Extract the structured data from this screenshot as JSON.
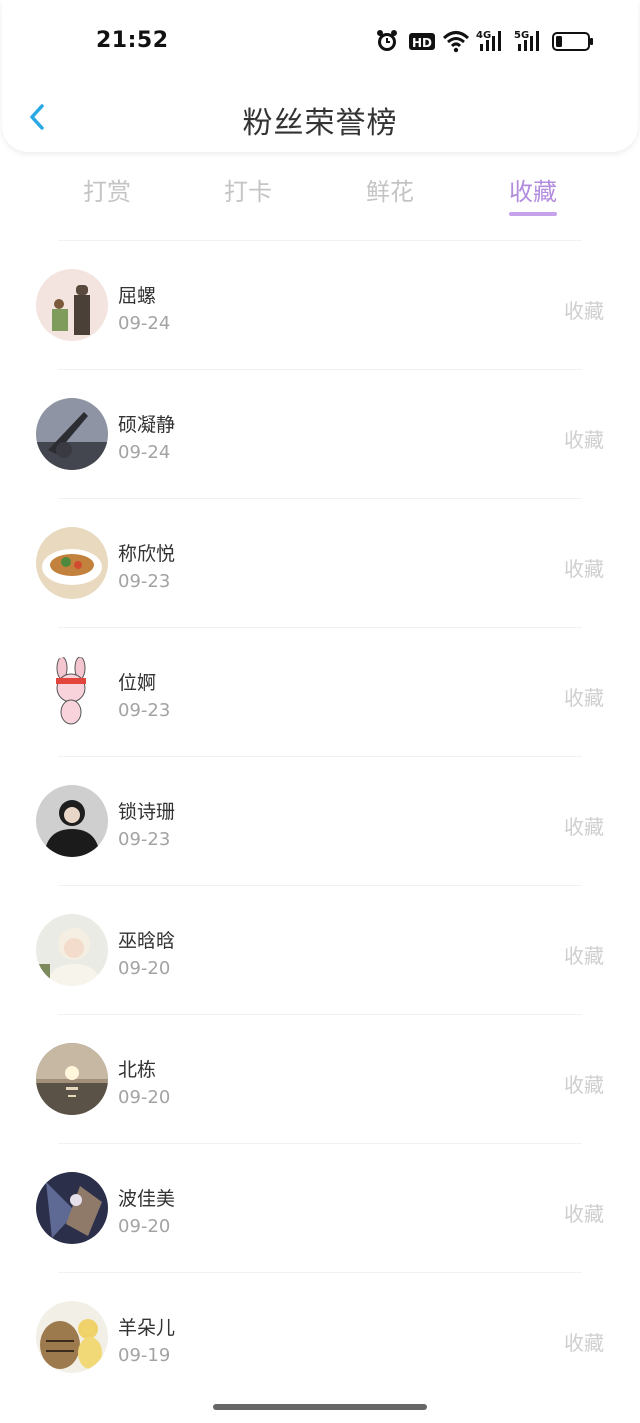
{
  "status_bar": {
    "time": "21:52",
    "icons": [
      "alarm-icon",
      "hd-icon",
      "wifi-icon",
      "signal-4g-icon",
      "signal-5g-icon",
      "battery-icon"
    ],
    "hd_label": "HD",
    "net1_label": "4G",
    "net2_label": "5G"
  },
  "nav": {
    "title": "粉丝荣誉榜",
    "back_icon": "chevron-left-icon"
  },
  "tabs": [
    {
      "label": "打赏",
      "active": false
    },
    {
      "label": "打卡",
      "active": false
    },
    {
      "label": "鲜花",
      "active": false
    },
    {
      "label": "收藏",
      "active": true
    }
  ],
  "colors": {
    "accent": "#b38cde",
    "back_icon": "#29a8e6",
    "inactive_tab": "#c4c4c4",
    "action_text": "#cfcfcf"
  },
  "fans": [
    {
      "name": "屈螺",
      "date": "09-24",
      "action": "收藏",
      "avatar": "couple-illustration-avatar"
    },
    {
      "name": "硕凝静",
      "date": "09-24",
      "action": "收藏",
      "avatar": "dark-landscape-avatar"
    },
    {
      "name": "称欣悦",
      "date": "09-23",
      "action": "收藏",
      "avatar": "food-bowl-avatar"
    },
    {
      "name": "位婀",
      "date": "09-23",
      "action": "收藏",
      "avatar": "cartoon-bunny-avatar"
    },
    {
      "name": "锁诗珊",
      "date": "09-23",
      "action": "收藏",
      "avatar": "person-portrait-avatar"
    },
    {
      "name": "巫晗晗",
      "date": "09-20",
      "action": "收藏",
      "avatar": "blond-portrait-avatar"
    },
    {
      "name": "北栋",
      "date": "09-20",
      "action": "收藏",
      "avatar": "sunset-sea-avatar"
    },
    {
      "name": "波佳美",
      "date": "09-20",
      "action": "收藏",
      "avatar": "anime-art-avatar"
    },
    {
      "name": "羊朵儿",
      "date": "09-19",
      "action": "收藏",
      "avatar": "cat-duck-avatar"
    }
  ]
}
